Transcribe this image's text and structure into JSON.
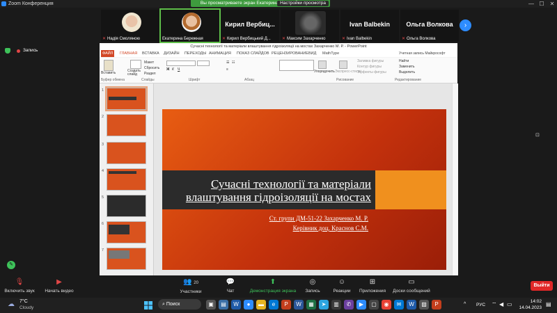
{
  "window": {
    "title": "Zoom Конференция",
    "share_banner": "Вы просматриваете экран Екатерина Бережная",
    "view_options": "Настройки просмотра",
    "controls": [
      "—",
      "☐",
      "✕"
    ]
  },
  "gallery": {
    "participants": [
      {
        "name": "Надія Смоляною",
        "muted": true
      },
      {
        "name": "Екатерина Бережная",
        "muted": false,
        "active": true
      },
      {
        "name": "Кирил Вербицький Д...",
        "display": "Кирил Вербиц...",
        "muted": true
      },
      {
        "name": "Максим Захарченко",
        "muted": true
      },
      {
        "name": "Ivan Balbekin",
        "display": "Ivan Balbekin",
        "muted": true
      },
      {
        "name": "Ольга Волкова",
        "display": "Ольга Волкова",
        "muted": true
      }
    ],
    "next_icon": "chevron-right-icon"
  },
  "recording_label": "Запись",
  "ppt": {
    "title": "Сучасні технології та матеріали влаштування гідроізоляції на мостах Захарченко М. Р. - PowerPoint",
    "tabs": [
      "ФАЙЛ",
      "ГЛАВНАЯ",
      "ВСТАВКА",
      "ДИЗАЙН",
      "ПЕРЕХОДЫ",
      "АНИМАЦИЯ",
      "ПОКАЗ СЛАЙДОВ",
      "РЕЦЕНЗИРОВАНИЕ",
      "ВИД",
      "MathType"
    ],
    "account": "Учетная запись Майкрософт",
    "ribbon": {
      "groups": [
        "Буфер обмена",
        "Слайды",
        "Шрифт",
        "Абзац",
        "Рисование",
        "Редактирование"
      ],
      "paste": "Вставить",
      "new_slide": "Создать слайд",
      "layout": "Макет",
      "reset": "Сбросить",
      "section": "Раздел",
      "arrange": "Упорядочить",
      "quick_styles": "Экспресс-стили",
      "shape_fill": "Заливка фигуры",
      "shape_outline": "Контур фигуры",
      "shape_effects": "Эффекты фигуры",
      "find": "Найти",
      "replace": "Заменить",
      "select": "Выделить"
    },
    "thumb_numbers": [
      "1",
      "2",
      "3",
      "4",
      "5",
      "6",
      "7"
    ],
    "slide": {
      "title_line1": "Сучасні технології та матеріали",
      "title_line2": "влаштування гідроізоляції на мостах",
      "subtitle1": "Ст. групи ДМ-51-22 Захарченко М. Р.",
      "subtitle2": "Керівник доц. Краснов С.М."
    }
  },
  "toolbar": {
    "audio": "Включить звук",
    "video": "Начать видео",
    "participants": "Участники",
    "participants_count": "20",
    "chat": "Чат",
    "share": "Демонстрация экрана",
    "record": "Запись",
    "reactions": "Реакции",
    "apps": "Приложения",
    "whiteboards": "Доски сообщений",
    "leave": "Выйти"
  },
  "taskbar": {
    "temp": "7°C",
    "weather": "Cloudy",
    "search": "Поиск",
    "lang": "РУС",
    "time": "14:02",
    "date": "14.04.2023"
  }
}
